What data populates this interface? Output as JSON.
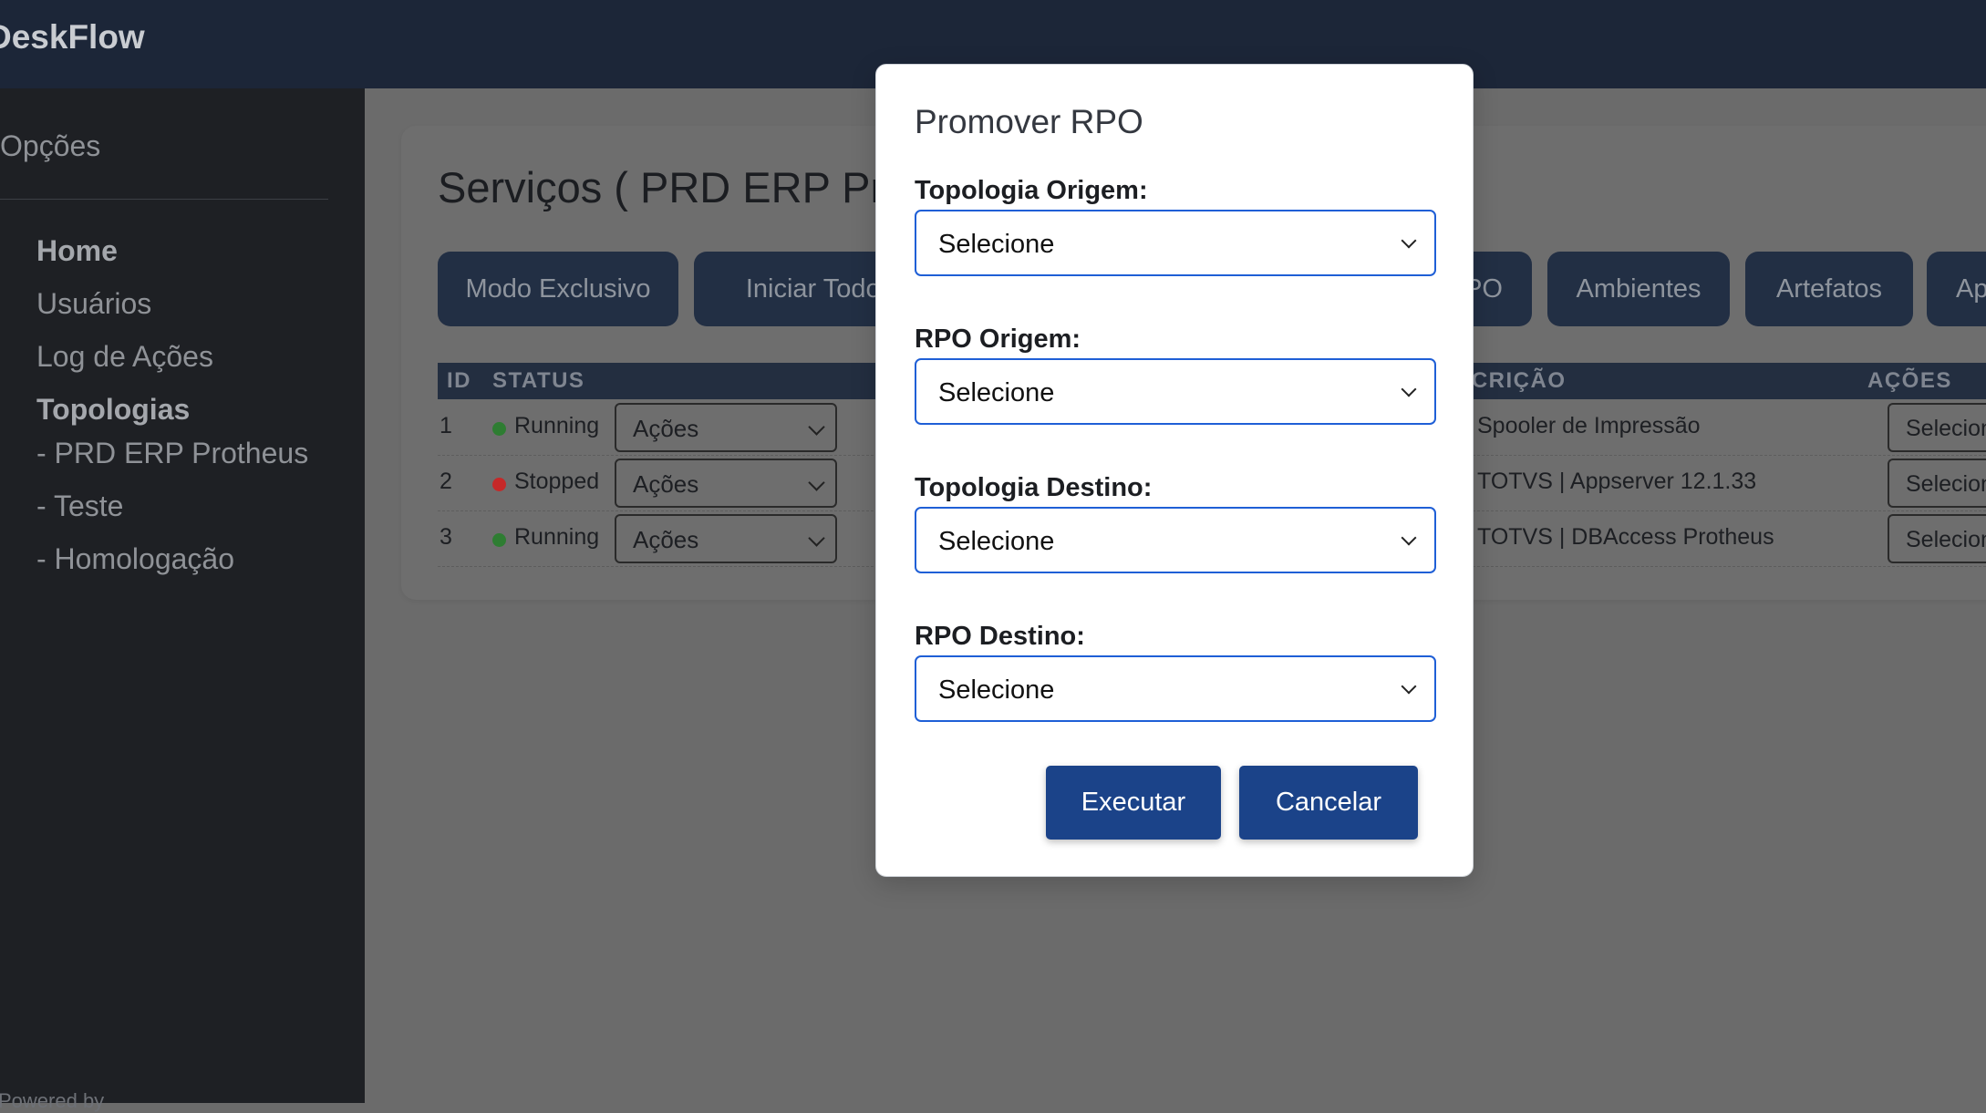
{
  "app": {
    "brand": "DeskFlow"
  },
  "sidebar": {
    "title": "Opções",
    "items": [
      {
        "label": "Home"
      },
      {
        "label": "Usuários"
      },
      {
        "label": "Log de Ações"
      },
      {
        "label": "Topologias"
      },
      {
        "label": "- PRD ERP Protheus"
      },
      {
        "label": "- Teste"
      },
      {
        "label": "- Homologação"
      }
    ],
    "footer": "Powered by"
  },
  "main": {
    "title": "Serviços ( PRD ERP Protheus )",
    "toolbar": [
      {
        "label": "Modo Exclusivo"
      },
      {
        "label": "Iniciar Todos"
      },
      {
        "label": "Promover RPO"
      },
      {
        "label": "Ambientes"
      },
      {
        "label": "Artefatos"
      },
      {
        "label": "Ap"
      }
    ],
    "table": {
      "headers": [
        "ID",
        "STATUS",
        "DESCRIÇÃO",
        "AÇÕES"
      ],
      "rows": [
        {
          "id": "1",
          "status": "Running",
          "status_color": "#2e7d32",
          "actions": "Ações",
          "description": "Spooler de Impressão",
          "select": "Selecione"
        },
        {
          "id": "2",
          "status": "Stopped",
          "status_color": "#c62828",
          "actions": "Ações",
          "description": "TOTVS | Appserver 12.1.33",
          "select": "Selecione"
        },
        {
          "id": "3",
          "status": "Running",
          "status_color": "#2e7d32",
          "actions": "Ações",
          "description": "TOTVS | DBAccess Protheus",
          "select": "Selecione"
        }
      ]
    }
  },
  "modal": {
    "title": "Promover RPO",
    "fields": [
      {
        "label": "Topologia Origem:",
        "value": "Selecione"
      },
      {
        "label": "RPO Origem:",
        "value": "Selecione"
      },
      {
        "label": "Topologia Destino:",
        "value": "Selecione"
      },
      {
        "label": "RPO Destino:",
        "value": "Selecione"
      }
    ],
    "execute_label": "Executar",
    "cancel_label": "Cancelar"
  },
  "colors": {
    "topbar": "#1c2638",
    "sidebar": "#1e2024",
    "primary_button": "#1b4389",
    "select_border": "#1f5fd6"
  }
}
